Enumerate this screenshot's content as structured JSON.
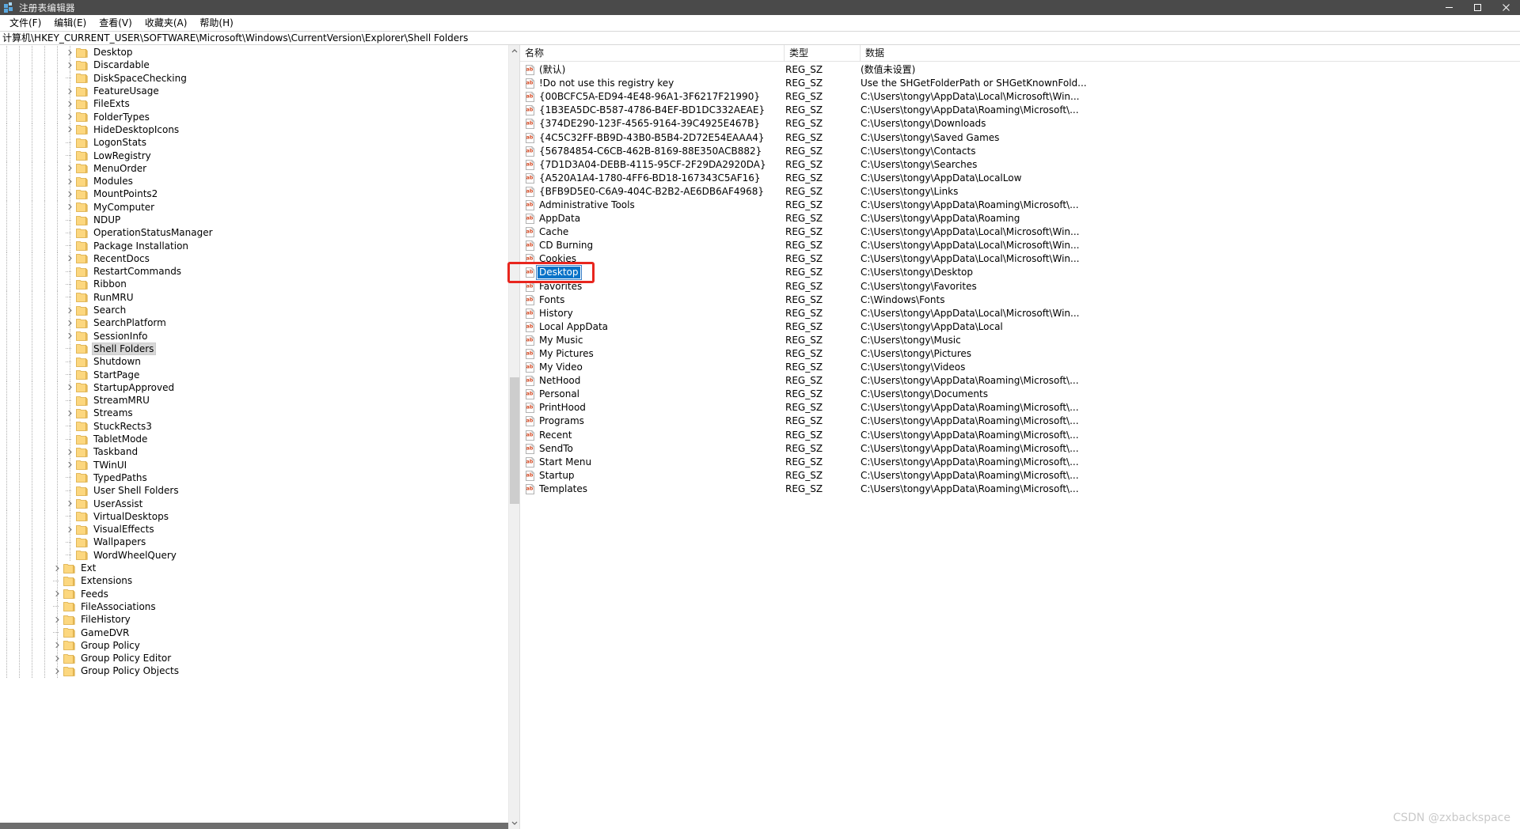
{
  "window": {
    "title": "注册表编辑器",
    "icon": "registry-icon",
    "minimize_label": "─",
    "maximize_label": "□",
    "close_label": "✕"
  },
  "menu": {
    "items": [
      {
        "label": "文件(F)"
      },
      {
        "label": "编辑(E)"
      },
      {
        "label": "查看(V)"
      },
      {
        "label": "收藏夹(A)"
      },
      {
        "label": "帮助(H)"
      }
    ]
  },
  "address": {
    "path": "计算机\\HKEY_CURRENT_USER\\SOFTWARE\\Microsoft\\Windows\\CurrentVersion\\Explorer\\Shell Folders"
  },
  "tree": {
    "items": [
      {
        "label": "Desktop",
        "indent": 6,
        "expander": "collapsed",
        "selected": false
      },
      {
        "label": "Discardable",
        "indent": 6,
        "expander": "collapsed",
        "selected": false
      },
      {
        "label": "DiskSpaceChecking",
        "indent": 6,
        "expander": "none",
        "selected": false
      },
      {
        "label": "FeatureUsage",
        "indent": 6,
        "expander": "collapsed",
        "selected": false
      },
      {
        "label": "FileExts",
        "indent": 6,
        "expander": "collapsed",
        "selected": false
      },
      {
        "label": "FolderTypes",
        "indent": 6,
        "expander": "collapsed",
        "selected": false
      },
      {
        "label": "HideDesktopIcons",
        "indent": 6,
        "expander": "collapsed",
        "selected": false
      },
      {
        "label": "LogonStats",
        "indent": 6,
        "expander": "none",
        "selected": false
      },
      {
        "label": "LowRegistry",
        "indent": 6,
        "expander": "none",
        "selected": false
      },
      {
        "label": "MenuOrder",
        "indent": 6,
        "expander": "collapsed",
        "selected": false
      },
      {
        "label": "Modules",
        "indent": 6,
        "expander": "collapsed",
        "selected": false
      },
      {
        "label": "MountPoints2",
        "indent": 6,
        "expander": "collapsed",
        "selected": false
      },
      {
        "label": "MyComputer",
        "indent": 6,
        "expander": "collapsed",
        "selected": false
      },
      {
        "label": "NDUP",
        "indent": 6,
        "expander": "none",
        "selected": false
      },
      {
        "label": "OperationStatusManager",
        "indent": 6,
        "expander": "none",
        "selected": false
      },
      {
        "label": "Package Installation",
        "indent": 6,
        "expander": "none",
        "selected": false
      },
      {
        "label": "RecentDocs",
        "indent": 6,
        "expander": "collapsed",
        "selected": false
      },
      {
        "label": "RestartCommands",
        "indent": 6,
        "expander": "none",
        "selected": false
      },
      {
        "label": "Ribbon",
        "indent": 6,
        "expander": "none",
        "selected": false
      },
      {
        "label": "RunMRU",
        "indent": 6,
        "expander": "none",
        "selected": false
      },
      {
        "label": "Search",
        "indent": 6,
        "expander": "collapsed",
        "selected": false
      },
      {
        "label": "SearchPlatform",
        "indent": 6,
        "expander": "collapsed",
        "selected": false
      },
      {
        "label": "SessionInfo",
        "indent": 6,
        "expander": "collapsed",
        "selected": false
      },
      {
        "label": "Shell Folders",
        "indent": 6,
        "expander": "none",
        "selected": true
      },
      {
        "label": "Shutdown",
        "indent": 6,
        "expander": "none",
        "selected": false
      },
      {
        "label": "StartPage",
        "indent": 6,
        "expander": "none",
        "selected": false
      },
      {
        "label": "StartupApproved",
        "indent": 6,
        "expander": "collapsed",
        "selected": false
      },
      {
        "label": "StreamMRU",
        "indent": 6,
        "expander": "none",
        "selected": false
      },
      {
        "label": "Streams",
        "indent": 6,
        "expander": "collapsed",
        "selected": false
      },
      {
        "label": "StuckRects3",
        "indent": 6,
        "expander": "none",
        "selected": false
      },
      {
        "label": "TabletMode",
        "indent": 6,
        "expander": "none",
        "selected": false
      },
      {
        "label": "Taskband",
        "indent": 6,
        "expander": "collapsed",
        "selected": false
      },
      {
        "label": "TWinUI",
        "indent": 6,
        "expander": "collapsed",
        "selected": false
      },
      {
        "label": "TypedPaths",
        "indent": 6,
        "expander": "none",
        "selected": false
      },
      {
        "label": "User Shell Folders",
        "indent": 6,
        "expander": "none",
        "selected": false
      },
      {
        "label": "UserAssist",
        "indent": 6,
        "expander": "collapsed",
        "selected": false
      },
      {
        "label": "VirtualDesktops",
        "indent": 6,
        "expander": "none",
        "selected": false
      },
      {
        "label": "VisualEffects",
        "indent": 6,
        "expander": "collapsed",
        "selected": false
      },
      {
        "label": "Wallpapers",
        "indent": 6,
        "expander": "none",
        "selected": false
      },
      {
        "label": "WordWheelQuery",
        "indent": 6,
        "expander": "none",
        "selected": false
      },
      {
        "label": "Ext",
        "indent": 5,
        "expander": "collapsed",
        "selected": false
      },
      {
        "label": "Extensions",
        "indent": 5,
        "expander": "none",
        "selected": false
      },
      {
        "label": "Feeds",
        "indent": 5,
        "expander": "collapsed",
        "selected": false
      },
      {
        "label": "FileAssociations",
        "indent": 5,
        "expander": "none",
        "selected": false
      },
      {
        "label": "FileHistory",
        "indent": 5,
        "expander": "collapsed",
        "selected": false
      },
      {
        "label": "GameDVR",
        "indent": 5,
        "expander": "none",
        "selected": false
      },
      {
        "label": "Group Policy",
        "indent": 5,
        "expander": "collapsed",
        "selected": false
      },
      {
        "label": "Group Policy Editor",
        "indent": 5,
        "expander": "collapsed",
        "selected": false
      },
      {
        "label": "Group Policy Objects",
        "indent": 5,
        "expander": "collapsed",
        "selected": false
      }
    ]
  },
  "values": {
    "columns": {
      "name": "名称",
      "type": "类型",
      "data": "数据"
    },
    "rows": [
      {
        "name": "(默认)",
        "type": "REG_SZ",
        "data": "(数值未设置)",
        "editing": false
      },
      {
        "name": "!Do not use this registry key",
        "type": "REG_SZ",
        "data": "Use the SHGetFolderPath or SHGetKnownFold...",
        "editing": false
      },
      {
        "name": "{00BCFC5A-ED94-4E48-96A1-3F6217F21990}",
        "type": "REG_SZ",
        "data": "C:\\Users\\tongy\\AppData\\Local\\Microsoft\\Win...",
        "editing": false
      },
      {
        "name": "{1B3EA5DC-B587-4786-B4EF-BD1DC332AEAE}",
        "type": "REG_SZ",
        "data": "C:\\Users\\tongy\\AppData\\Roaming\\Microsoft\\...",
        "editing": false
      },
      {
        "name": "{374DE290-123F-4565-9164-39C4925E467B}",
        "type": "REG_SZ",
        "data": "C:\\Users\\tongy\\Downloads",
        "editing": false
      },
      {
        "name": "{4C5C32FF-BB9D-43B0-B5B4-2D72E54EAAA4}",
        "type": "REG_SZ",
        "data": "C:\\Users\\tongy\\Saved Games",
        "editing": false
      },
      {
        "name": "{56784854-C6CB-462B-8169-88E350ACB882}",
        "type": "REG_SZ",
        "data": "C:\\Users\\tongy\\Contacts",
        "editing": false
      },
      {
        "name": "{7D1D3A04-DEBB-4115-95CF-2F29DA2920DA}",
        "type": "REG_SZ",
        "data": "C:\\Users\\tongy\\Searches",
        "editing": false
      },
      {
        "name": "{A520A1A4-1780-4FF6-BD18-167343C5AF16}",
        "type": "REG_SZ",
        "data": "C:\\Users\\tongy\\AppData\\LocalLow",
        "editing": false
      },
      {
        "name": "{BFB9D5E0-C6A9-404C-B2B2-AE6DB6AF4968}",
        "type": "REG_SZ",
        "data": "C:\\Users\\tongy\\Links",
        "editing": false
      },
      {
        "name": "Administrative Tools",
        "type": "REG_SZ",
        "data": "C:\\Users\\tongy\\AppData\\Roaming\\Microsoft\\...",
        "editing": false
      },
      {
        "name": "AppData",
        "type": "REG_SZ",
        "data": "C:\\Users\\tongy\\AppData\\Roaming",
        "editing": false
      },
      {
        "name": "Cache",
        "type": "REG_SZ",
        "data": "C:\\Users\\tongy\\AppData\\Local\\Microsoft\\Win...",
        "editing": false
      },
      {
        "name": "CD Burning",
        "type": "REG_SZ",
        "data": "C:\\Users\\tongy\\AppData\\Local\\Microsoft\\Win...",
        "editing": false
      },
      {
        "name": "Cookies",
        "type": "REG_SZ",
        "data": "C:\\Users\\tongy\\AppData\\Local\\Microsoft\\Win...",
        "editing": false
      },
      {
        "name": "Desktop",
        "type": "REG_SZ",
        "data": "C:\\Users\\tongy\\Desktop",
        "editing": true
      },
      {
        "name": "Favorites",
        "type": "REG_SZ",
        "data": "C:\\Users\\tongy\\Favorites",
        "editing": false
      },
      {
        "name": "Fonts",
        "type": "REG_SZ",
        "data": "C:\\Windows\\Fonts",
        "editing": false
      },
      {
        "name": "History",
        "type": "REG_SZ",
        "data": "C:\\Users\\tongy\\AppData\\Local\\Microsoft\\Win...",
        "editing": false
      },
      {
        "name": "Local AppData",
        "type": "REG_SZ",
        "data": "C:\\Users\\tongy\\AppData\\Local",
        "editing": false
      },
      {
        "name": "My Music",
        "type": "REG_SZ",
        "data": "C:\\Users\\tongy\\Music",
        "editing": false
      },
      {
        "name": "My Pictures",
        "type": "REG_SZ",
        "data": "C:\\Users\\tongy\\Pictures",
        "editing": false
      },
      {
        "name": "My Video",
        "type": "REG_SZ",
        "data": "C:\\Users\\tongy\\Videos",
        "editing": false
      },
      {
        "name": "NetHood",
        "type": "REG_SZ",
        "data": "C:\\Users\\tongy\\AppData\\Roaming\\Microsoft\\...",
        "editing": false
      },
      {
        "name": "Personal",
        "type": "REG_SZ",
        "data": "C:\\Users\\tongy\\Documents",
        "editing": false
      },
      {
        "name": "PrintHood",
        "type": "REG_SZ",
        "data": "C:\\Users\\tongy\\AppData\\Roaming\\Microsoft\\...",
        "editing": false
      },
      {
        "name": "Programs",
        "type": "REG_SZ",
        "data": "C:\\Users\\tongy\\AppData\\Roaming\\Microsoft\\...",
        "editing": false
      },
      {
        "name": "Recent",
        "type": "REG_SZ",
        "data": "C:\\Users\\tongy\\AppData\\Roaming\\Microsoft\\...",
        "editing": false
      },
      {
        "name": "SendTo",
        "type": "REG_SZ",
        "data": "C:\\Users\\tongy\\AppData\\Roaming\\Microsoft\\...",
        "editing": false
      },
      {
        "name": "Start Menu",
        "type": "REG_SZ",
        "data": "C:\\Users\\tongy\\AppData\\Roaming\\Microsoft\\...",
        "editing": false
      },
      {
        "name": "Startup",
        "type": "REG_SZ",
        "data": "C:\\Users\\tongy\\AppData\\Roaming\\Microsoft\\...",
        "editing": false
      },
      {
        "name": "Templates",
        "type": "REG_SZ",
        "data": "C:\\Users\\tongy\\AppData\\Roaming\\Microsoft\\...",
        "editing": false
      }
    ]
  },
  "annotation": {
    "color": "#e8261e",
    "target": "Desktop"
  },
  "watermark": {
    "text": "CSDN @zxbackspace"
  }
}
